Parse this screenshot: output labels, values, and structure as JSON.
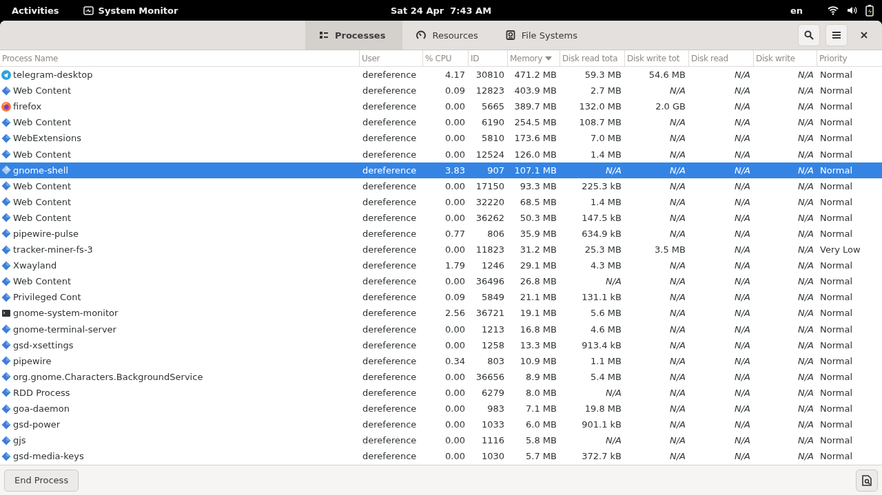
{
  "top_bar": {
    "activities": "Activities",
    "app_name": "System Monitor",
    "clock": "Sat 24 Apr  7:43 AM",
    "language": "en"
  },
  "tabs": [
    {
      "label": "Processes",
      "selected": true
    },
    {
      "label": "Resources",
      "selected": false
    },
    {
      "label": "File Systems",
      "selected": false
    }
  ],
  "table": {
    "columns": [
      {
        "label": "Process Name",
        "sorted": false
      },
      {
        "label": "User",
        "sorted": false
      },
      {
        "label": "% CPU",
        "sorted": false
      },
      {
        "label": "ID",
        "sorted": false
      },
      {
        "label": "Memory",
        "sorted": true
      },
      {
        "label": "Disk read tota",
        "sorted": false
      },
      {
        "label": "Disk write tot",
        "sorted": false
      },
      {
        "label": "Disk read",
        "sorted": false
      },
      {
        "label": "Disk write",
        "sorted": false
      },
      {
        "label": "Priority",
        "sorted": false
      }
    ],
    "rows": [
      {
        "kind": "telegram",
        "selected": false,
        "cells": [
          "telegram-desktop",
          "dereference",
          "4.17",
          "30810",
          "471.2 MB",
          "59.3 MB",
          "54.6 MB",
          {
            "text": "N/A",
            "italic": true
          },
          {
            "text": "N/A",
            "italic": true
          },
          "Normal"
        ]
      },
      {
        "kind": "generic",
        "selected": false,
        "cells": [
          "Web Content",
          "dereference",
          "0.09",
          "12823",
          "403.9 MB",
          "2.7 MB",
          {
            "text": "N/A",
            "italic": true
          },
          {
            "text": "N/A",
            "italic": true
          },
          {
            "text": "N/A",
            "italic": true
          },
          "Normal"
        ]
      },
      {
        "kind": "firefox",
        "selected": false,
        "cells": [
          "firefox",
          "dereference",
          "0.00",
          "5665",
          "389.7 MB",
          "132.0 MB",
          "2.0 GB",
          {
            "text": "N/A",
            "italic": true
          },
          {
            "text": "N/A",
            "italic": true
          },
          "Normal"
        ]
      },
      {
        "kind": "generic",
        "selected": false,
        "cells": [
          "Web Content",
          "dereference",
          "0.00",
          "6190",
          "254.5 MB",
          "108.7 MB",
          {
            "text": "N/A",
            "italic": true
          },
          {
            "text": "N/A",
            "italic": true
          },
          {
            "text": "N/A",
            "italic": true
          },
          "Normal"
        ]
      },
      {
        "kind": "generic",
        "selected": false,
        "cells": [
          "WebExtensions",
          "dereference",
          "0.00",
          "5810",
          "173.6 MB",
          "7.0 MB",
          {
            "text": "N/A",
            "italic": true
          },
          {
            "text": "N/A",
            "italic": true
          },
          {
            "text": "N/A",
            "italic": true
          },
          "Normal"
        ]
      },
      {
        "kind": "generic",
        "selected": false,
        "cells": [
          "Web Content",
          "dereference",
          "0.00",
          "12524",
          "126.0 MB",
          "1.4 MB",
          {
            "text": "N/A",
            "italic": true
          },
          {
            "text": "N/A",
            "italic": true
          },
          {
            "text": "N/A",
            "italic": true
          },
          "Normal"
        ]
      },
      {
        "kind": "generic",
        "selected": true,
        "cells": [
          "gnome-shell",
          "dereference",
          "3.83",
          "907",
          "107.1 MB",
          {
            "text": "N/A",
            "italic": true
          },
          {
            "text": "N/A",
            "italic": true
          },
          {
            "text": "N/A",
            "italic": true
          },
          {
            "text": "N/A",
            "italic": true
          },
          "Normal"
        ]
      },
      {
        "kind": "generic",
        "selected": false,
        "cells": [
          "Web Content",
          "dereference",
          "0.00",
          "17150",
          "93.3 MB",
          "225.3 kB",
          {
            "text": "N/A",
            "italic": true
          },
          {
            "text": "N/A",
            "italic": true
          },
          {
            "text": "N/A",
            "italic": true
          },
          "Normal"
        ]
      },
      {
        "kind": "generic",
        "selected": false,
        "cells": [
          "Web Content",
          "dereference",
          "0.00",
          "32220",
          "68.5 MB",
          "1.4 MB",
          {
            "text": "N/A",
            "italic": true
          },
          {
            "text": "N/A",
            "italic": true
          },
          {
            "text": "N/A",
            "italic": true
          },
          "Normal"
        ]
      },
      {
        "kind": "generic",
        "selected": false,
        "cells": [
          "Web Content",
          "dereference",
          "0.00",
          "36262",
          "50.3 MB",
          "147.5 kB",
          {
            "text": "N/A",
            "italic": true
          },
          {
            "text": "N/A",
            "italic": true
          },
          {
            "text": "N/A",
            "italic": true
          },
          "Normal"
        ]
      },
      {
        "kind": "generic",
        "selected": false,
        "cells": [
          "pipewire-pulse",
          "dereference",
          "0.77",
          "806",
          "35.9 MB",
          "634.9 kB",
          {
            "text": "N/A",
            "italic": true
          },
          {
            "text": "N/A",
            "italic": true
          },
          {
            "text": "N/A",
            "italic": true
          },
          "Normal"
        ]
      },
      {
        "kind": "generic",
        "selected": false,
        "cells": [
          "tracker-miner-fs-3",
          "dereference",
          "0.00",
          "11823",
          "31.2 MB",
          "25.3 MB",
          "3.5 MB",
          {
            "text": "N/A",
            "italic": true
          },
          {
            "text": "N/A",
            "italic": true
          },
          "Very Low"
        ]
      },
      {
        "kind": "generic",
        "selected": false,
        "cells": [
          "Xwayland",
          "dereference",
          "1.79",
          "1246",
          "29.1 MB",
          "4.3 MB",
          {
            "text": "N/A",
            "italic": true
          },
          {
            "text": "N/A",
            "italic": true
          },
          {
            "text": "N/A",
            "italic": true
          },
          "Normal"
        ]
      },
      {
        "kind": "generic",
        "selected": false,
        "cells": [
          "Web Content",
          "dereference",
          "0.00",
          "36496",
          "26.8 MB",
          {
            "text": "N/A",
            "italic": true
          },
          {
            "text": "N/A",
            "italic": true
          },
          {
            "text": "N/A",
            "italic": true
          },
          {
            "text": "N/A",
            "italic": true
          },
          "Normal"
        ]
      },
      {
        "kind": "generic",
        "selected": false,
        "cells": [
          "Privileged Cont",
          "dereference",
          "0.09",
          "5849",
          "21.1 MB",
          "131.1 kB",
          {
            "text": "N/A",
            "italic": true
          },
          {
            "text": "N/A",
            "italic": true
          },
          {
            "text": "N/A",
            "italic": true
          },
          "Normal"
        ]
      },
      {
        "kind": "terminal",
        "selected": false,
        "cells": [
          "gnome-system-monitor",
          "dereference",
          "2.56",
          "36721",
          "19.1 MB",
          "5.6 MB",
          {
            "text": "N/A",
            "italic": true
          },
          {
            "text": "N/A",
            "italic": true
          },
          {
            "text": "N/A",
            "italic": true
          },
          "Normal"
        ]
      },
      {
        "kind": "generic",
        "selected": false,
        "cells": [
          "gnome-terminal-server",
          "dereference",
          "0.00",
          "1213",
          "16.8 MB",
          "4.6 MB",
          {
            "text": "N/A",
            "italic": true
          },
          {
            "text": "N/A",
            "italic": true
          },
          {
            "text": "N/A",
            "italic": true
          },
          "Normal"
        ]
      },
      {
        "kind": "generic",
        "selected": false,
        "cells": [
          "gsd-xsettings",
          "dereference",
          "0.00",
          "1258",
          "13.3 MB",
          "913.4 kB",
          {
            "text": "N/A",
            "italic": true
          },
          {
            "text": "N/A",
            "italic": true
          },
          {
            "text": "N/A",
            "italic": true
          },
          "Normal"
        ]
      },
      {
        "kind": "generic",
        "selected": false,
        "cells": [
          "pipewire",
          "dereference",
          "0.34",
          "803",
          "10.9 MB",
          "1.1 MB",
          {
            "text": "N/A",
            "italic": true
          },
          {
            "text": "N/A",
            "italic": true
          },
          {
            "text": "N/A",
            "italic": true
          },
          "Normal"
        ]
      },
      {
        "kind": "generic",
        "selected": false,
        "cells": [
          "org.gnome.Characters.BackgroundService",
          "dereference",
          "0.00",
          "36656",
          "8.9 MB",
          "5.4 MB",
          {
            "text": "N/A",
            "italic": true
          },
          {
            "text": "N/A",
            "italic": true
          },
          {
            "text": "N/A",
            "italic": true
          },
          "Normal"
        ]
      },
      {
        "kind": "generic",
        "selected": false,
        "cells": [
          "RDD Process",
          "dereference",
          "0.00",
          "6279",
          "8.0 MB",
          {
            "text": "N/A",
            "italic": true
          },
          {
            "text": "N/A",
            "italic": true
          },
          {
            "text": "N/A",
            "italic": true
          },
          {
            "text": "N/A",
            "italic": true
          },
          "Normal"
        ]
      },
      {
        "kind": "generic",
        "selected": false,
        "cells": [
          "goa-daemon",
          "dereference",
          "0.00",
          "983",
          "7.1 MB",
          "19.8 MB",
          {
            "text": "N/A",
            "italic": true
          },
          {
            "text": "N/A",
            "italic": true
          },
          {
            "text": "N/A",
            "italic": true
          },
          "Normal"
        ]
      },
      {
        "kind": "generic",
        "selected": false,
        "cells": [
          "gsd-power",
          "dereference",
          "0.00",
          "1033",
          "6.0 MB",
          "901.1 kB",
          {
            "text": "N/A",
            "italic": true
          },
          {
            "text": "N/A",
            "italic": true
          },
          {
            "text": "N/A",
            "italic": true
          },
          "Normal"
        ]
      },
      {
        "kind": "generic",
        "selected": false,
        "cells": [
          "gjs",
          "dereference",
          "0.00",
          "1116",
          "5.8 MB",
          {
            "text": "N/A",
            "italic": true
          },
          {
            "text": "N/A",
            "italic": true
          },
          {
            "text": "N/A",
            "italic": true
          },
          {
            "text": "N/A",
            "italic": true
          },
          "Normal"
        ]
      },
      {
        "kind": "generic",
        "selected": false,
        "cells": [
          "gsd-media-keys",
          "dereference",
          "0.00",
          "1030",
          "5.7 MB",
          "372.7 kB",
          {
            "text": "N/A",
            "italic": true
          },
          {
            "text": "N/A",
            "italic": true
          },
          {
            "text": "N/A",
            "italic": true
          },
          "Normal"
        ]
      }
    ]
  },
  "bottom_bar": {
    "end_button": "End Process"
  }
}
